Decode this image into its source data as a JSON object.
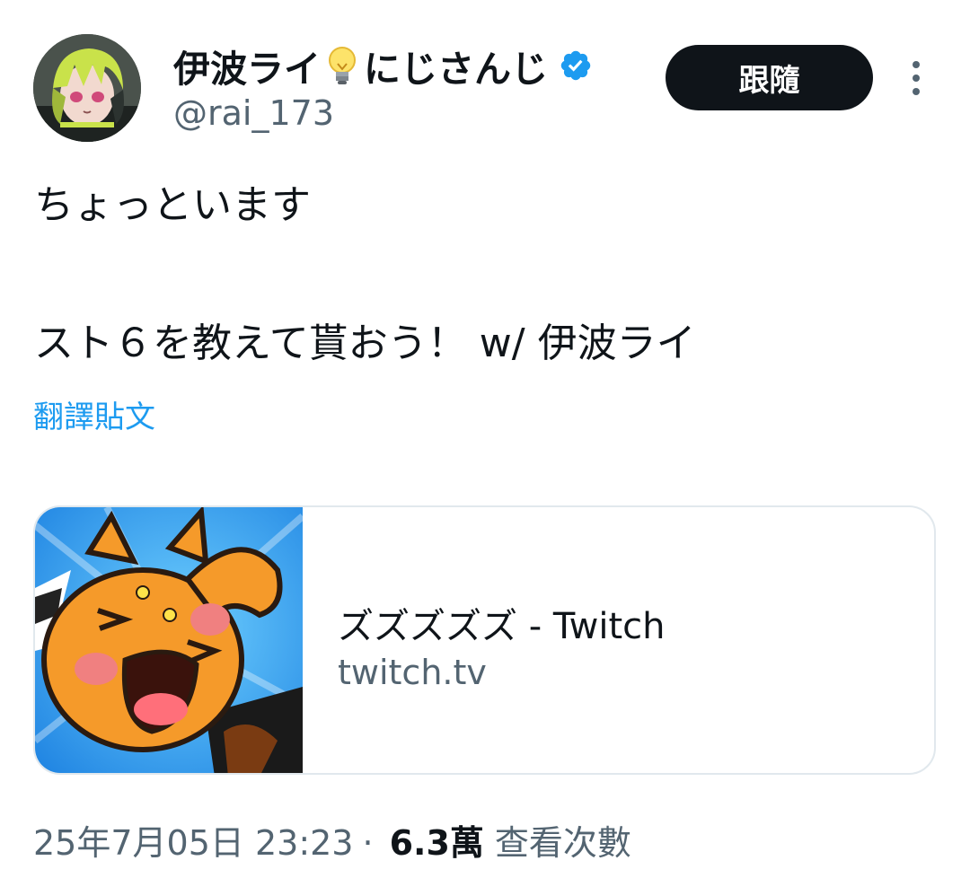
{
  "author": {
    "display_name": "伊波ライ",
    "display_name_suffix": "にじさんじ",
    "handle": "@rai_173",
    "name_icon": "lightbulb-icon",
    "verified_icon": "verified-badge-icon"
  },
  "actions": {
    "follow_label": "跟隨",
    "more_icon": "more-vertical-icon"
  },
  "tweet": {
    "line1": "ちょっといます",
    "line2": "スト６を教えて貰おう！ w/ 伊波ライ",
    "translate_label": "翻譯貼文"
  },
  "card": {
    "title": "ズズズズズ - Twitch",
    "domain": "twitch.tv"
  },
  "meta": {
    "timestamp": "25年7月05日 23:23",
    "separator": "·",
    "views_count": "6.3萬",
    "views_label": "查看次數"
  },
  "colors": {
    "accent": "#1d9bf0",
    "text_primary": "#0f1419",
    "text_secondary": "#536471",
    "follow_bg": "#0f1419"
  }
}
